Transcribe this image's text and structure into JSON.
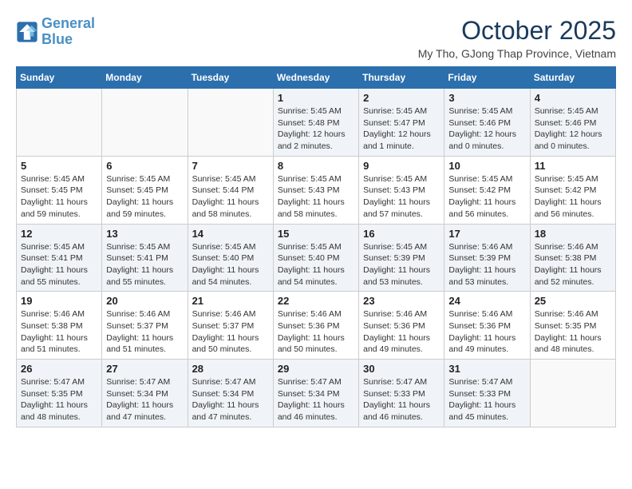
{
  "logo": {
    "line1": "General",
    "line2": "Blue"
  },
  "title": "October 2025",
  "location": "My Tho, GJong Thap Province, Vietnam",
  "days_of_week": [
    "Sunday",
    "Monday",
    "Tuesday",
    "Wednesday",
    "Thursday",
    "Friday",
    "Saturday"
  ],
  "weeks": [
    [
      {
        "day": "",
        "info": ""
      },
      {
        "day": "",
        "info": ""
      },
      {
        "day": "",
        "info": ""
      },
      {
        "day": "1",
        "info": "Sunrise: 5:45 AM\nSunset: 5:48 PM\nDaylight: 12 hours\nand 2 minutes."
      },
      {
        "day": "2",
        "info": "Sunrise: 5:45 AM\nSunset: 5:47 PM\nDaylight: 12 hours\nand 1 minute."
      },
      {
        "day": "3",
        "info": "Sunrise: 5:45 AM\nSunset: 5:46 PM\nDaylight: 12 hours\nand 0 minutes."
      },
      {
        "day": "4",
        "info": "Sunrise: 5:45 AM\nSunset: 5:46 PM\nDaylight: 12 hours\nand 0 minutes."
      }
    ],
    [
      {
        "day": "5",
        "info": "Sunrise: 5:45 AM\nSunset: 5:45 PM\nDaylight: 11 hours\nand 59 minutes."
      },
      {
        "day": "6",
        "info": "Sunrise: 5:45 AM\nSunset: 5:45 PM\nDaylight: 11 hours\nand 59 minutes."
      },
      {
        "day": "7",
        "info": "Sunrise: 5:45 AM\nSunset: 5:44 PM\nDaylight: 11 hours\nand 58 minutes."
      },
      {
        "day": "8",
        "info": "Sunrise: 5:45 AM\nSunset: 5:43 PM\nDaylight: 11 hours\nand 58 minutes."
      },
      {
        "day": "9",
        "info": "Sunrise: 5:45 AM\nSunset: 5:43 PM\nDaylight: 11 hours\nand 57 minutes."
      },
      {
        "day": "10",
        "info": "Sunrise: 5:45 AM\nSunset: 5:42 PM\nDaylight: 11 hours\nand 56 minutes."
      },
      {
        "day": "11",
        "info": "Sunrise: 5:45 AM\nSunset: 5:42 PM\nDaylight: 11 hours\nand 56 minutes."
      }
    ],
    [
      {
        "day": "12",
        "info": "Sunrise: 5:45 AM\nSunset: 5:41 PM\nDaylight: 11 hours\nand 55 minutes."
      },
      {
        "day": "13",
        "info": "Sunrise: 5:45 AM\nSunset: 5:41 PM\nDaylight: 11 hours\nand 55 minutes."
      },
      {
        "day": "14",
        "info": "Sunrise: 5:45 AM\nSunset: 5:40 PM\nDaylight: 11 hours\nand 54 minutes."
      },
      {
        "day": "15",
        "info": "Sunrise: 5:45 AM\nSunset: 5:40 PM\nDaylight: 11 hours\nand 54 minutes."
      },
      {
        "day": "16",
        "info": "Sunrise: 5:45 AM\nSunset: 5:39 PM\nDaylight: 11 hours\nand 53 minutes."
      },
      {
        "day": "17",
        "info": "Sunrise: 5:46 AM\nSunset: 5:39 PM\nDaylight: 11 hours\nand 53 minutes."
      },
      {
        "day": "18",
        "info": "Sunrise: 5:46 AM\nSunset: 5:38 PM\nDaylight: 11 hours\nand 52 minutes."
      }
    ],
    [
      {
        "day": "19",
        "info": "Sunrise: 5:46 AM\nSunset: 5:38 PM\nDaylight: 11 hours\nand 51 minutes."
      },
      {
        "day": "20",
        "info": "Sunrise: 5:46 AM\nSunset: 5:37 PM\nDaylight: 11 hours\nand 51 minutes."
      },
      {
        "day": "21",
        "info": "Sunrise: 5:46 AM\nSunset: 5:37 PM\nDaylight: 11 hours\nand 50 minutes."
      },
      {
        "day": "22",
        "info": "Sunrise: 5:46 AM\nSunset: 5:36 PM\nDaylight: 11 hours\nand 50 minutes."
      },
      {
        "day": "23",
        "info": "Sunrise: 5:46 AM\nSunset: 5:36 PM\nDaylight: 11 hours\nand 49 minutes."
      },
      {
        "day": "24",
        "info": "Sunrise: 5:46 AM\nSunset: 5:36 PM\nDaylight: 11 hours\nand 49 minutes."
      },
      {
        "day": "25",
        "info": "Sunrise: 5:46 AM\nSunset: 5:35 PM\nDaylight: 11 hours\nand 48 minutes."
      }
    ],
    [
      {
        "day": "26",
        "info": "Sunrise: 5:47 AM\nSunset: 5:35 PM\nDaylight: 11 hours\nand 48 minutes."
      },
      {
        "day": "27",
        "info": "Sunrise: 5:47 AM\nSunset: 5:34 PM\nDaylight: 11 hours\nand 47 minutes."
      },
      {
        "day": "28",
        "info": "Sunrise: 5:47 AM\nSunset: 5:34 PM\nDaylight: 11 hours\nand 47 minutes."
      },
      {
        "day": "29",
        "info": "Sunrise: 5:47 AM\nSunset: 5:34 PM\nDaylight: 11 hours\nand 46 minutes."
      },
      {
        "day": "30",
        "info": "Sunrise: 5:47 AM\nSunset: 5:33 PM\nDaylight: 11 hours\nand 46 minutes."
      },
      {
        "day": "31",
        "info": "Sunrise: 5:47 AM\nSunset: 5:33 PM\nDaylight: 11 hours\nand 45 minutes."
      },
      {
        "day": "",
        "info": ""
      }
    ]
  ]
}
